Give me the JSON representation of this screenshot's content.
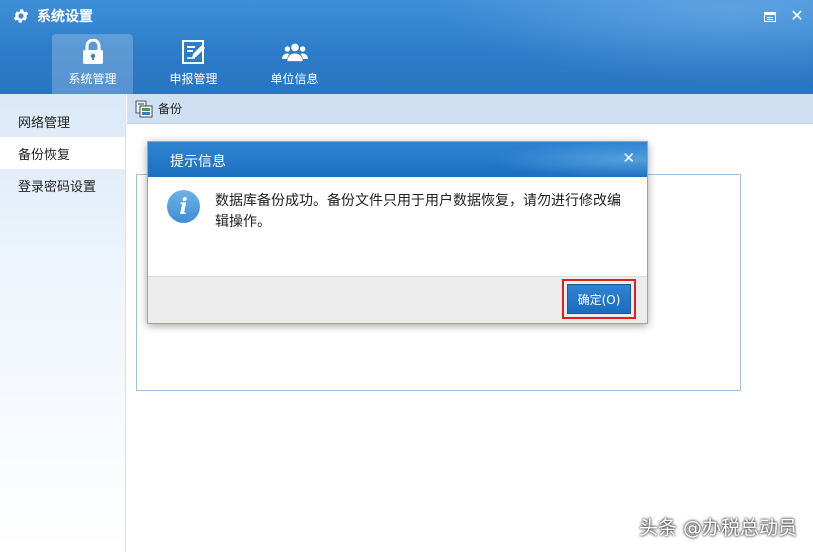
{
  "window": {
    "title": "系统设置",
    "icon": "gear-icon"
  },
  "nav": {
    "tabs": [
      {
        "label": "系统管理",
        "icon": "lock-icon",
        "active": true
      },
      {
        "label": "申报管理",
        "icon": "edit-document-icon",
        "active": false
      },
      {
        "label": "单位信息",
        "icon": "users-icon",
        "active": false
      }
    ]
  },
  "sidebar": {
    "items": [
      {
        "label": "网络管理",
        "active": false
      },
      {
        "label": "备份恢复",
        "active": true
      },
      {
        "label": "登录密码设置",
        "active": false
      }
    ]
  },
  "content": {
    "title": "备份",
    "icon": "backup-icon"
  },
  "dialog": {
    "title": "提示信息",
    "icon": "info-icon",
    "message": "数据库备份成功。备份文件只用于用户数据恢复，请勿进行修改编辑操作。",
    "ok_label": "确定(O)"
  },
  "watermark": "头条 @办税总动员",
  "colors": {
    "header": "#2d7cc9",
    "accent": "#1d6fc0",
    "highlight": "#e02020"
  }
}
